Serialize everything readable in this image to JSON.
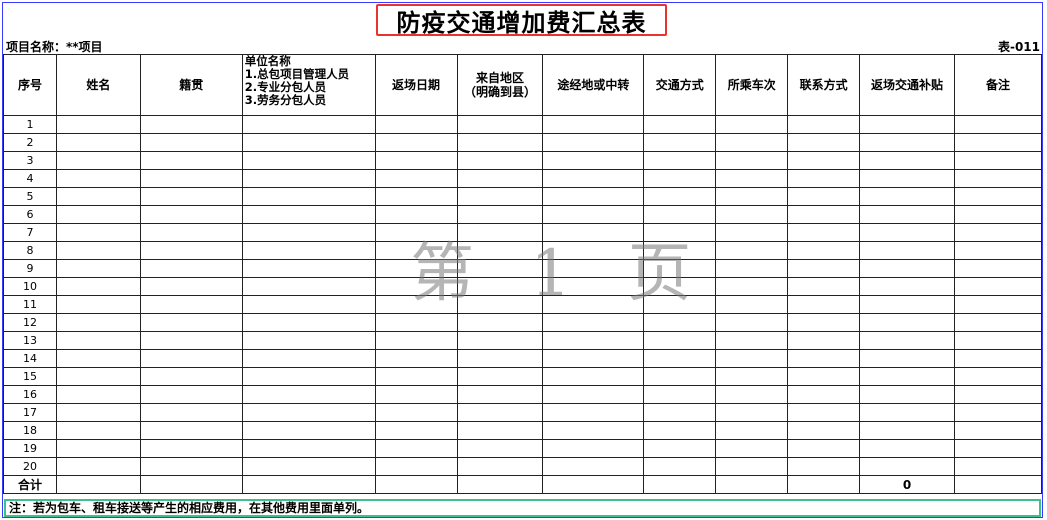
{
  "title": "防疫交通增加费汇总表",
  "project_label": "项目名称：**项目",
  "form_code": "表-011",
  "headers": {
    "seq": "序号",
    "name": "姓名",
    "origin": "籍贯",
    "unit_title": "单位名称",
    "unit_line1": "1.总包项目管理人员",
    "unit_line2": "2.专业分包人员",
    "unit_line3": "3.劳务分包人员",
    "return_date": "返场日期",
    "from_region_1": "来自地区",
    "from_region_2": "（明确到县）",
    "via": "途经地或中转",
    "transport": "交通方式",
    "train_no": "所乘车次",
    "contact": "联系方式",
    "subsidy": "返场交通补贴",
    "remark": "备注"
  },
  "rows": [
    "1",
    "2",
    "3",
    "4",
    "5",
    "6",
    "7",
    "8",
    "9",
    "10",
    "11",
    "12",
    "13",
    "14",
    "15",
    "16",
    "17",
    "18",
    "19",
    "20"
  ],
  "total_label": "合计",
  "total_subsidy": "0",
  "note": "注：若为包车、租车接送等产生的相应费用，在其他费用里面单列。",
  "watermark": "第 1 页",
  "colors": {
    "title_border": "#e8342f",
    "note_border": "#3dbf8e",
    "sheet_border": "#3a3aff"
  }
}
